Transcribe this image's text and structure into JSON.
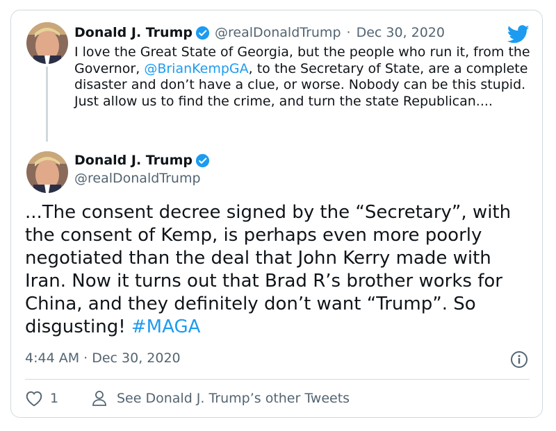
{
  "colors": {
    "accent": "#1d9bf0",
    "text": "#0f1419",
    "muted": "#536471",
    "border": "#cfd9de"
  },
  "reply_tweet": {
    "author_name": "Donald J. Trump",
    "handle": "@realDonaldTrump",
    "separator": "·",
    "date": "Dec 30, 2020",
    "text_before_mention": "I love the Great State of Georgia, but the people who run it, from the Governor, ",
    "mention": "@BrianKempGA",
    "text_after_mention": ", to the Secretary of State, are a complete disaster and don’t have a clue, or worse. Nobody can be this stupid. Just allow us to find the crime, and turn the state Republican....",
    "verified_icon": "verified-badge-icon"
  },
  "main_tweet": {
    "author_name": "Donald J. Trump",
    "handle": "@realDonaldTrump",
    "text": "...The consent decree signed by the “Secretary”, with the consent of Kemp, is perhaps even more poorly negotiated than the deal that John Kerry made with Iran. Now it turns out that Brad R’s brother works for China, and they definitely don’t want “Trump”. So disgusting! ",
    "hashtag": "#MAGA",
    "timestamp": "4:44 AM · Dec 30, 2020",
    "verified_icon": "verified-badge-icon"
  },
  "actions": {
    "like_count": "1",
    "like_icon": "heart-icon",
    "profile_icon": "person-icon",
    "see_other_tweets": "See Donald J. Trump’s other Tweets"
  },
  "icons": {
    "logo": "twitter-bird-icon",
    "info": "info-icon"
  }
}
